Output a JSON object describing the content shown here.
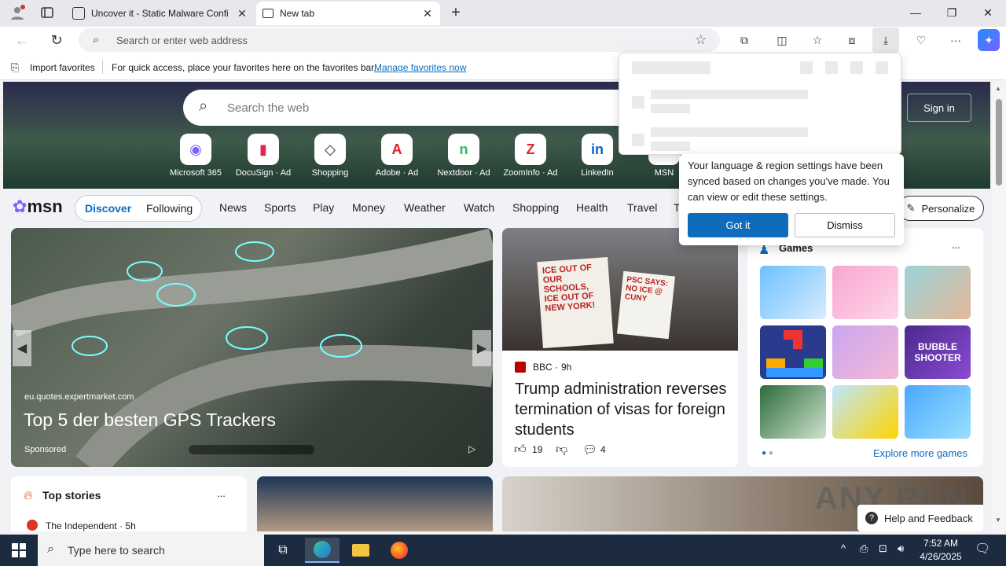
{
  "tabs": {
    "inactive_title": "Uncover it - Static Malware Confi",
    "active_title": "New tab"
  },
  "addressbar": {
    "placeholder": "Search or enter web address"
  },
  "favorites": {
    "import_label": "Import favorites",
    "message": "For quick access, place your favorites here on the favorites bar.",
    "manage_link": "Manage favorites now"
  },
  "hero": {
    "search_placeholder": "Search the web",
    "signin_label": "Sign in",
    "quicklinks": [
      {
        "label": "Microsoft 365",
        "glyph": "◉",
        "color": "#7b61ff"
      },
      {
        "label": "DocuSign · Ad",
        "glyph": "▮",
        "color": "#e3264f"
      },
      {
        "label": "Shopping",
        "glyph": "◇",
        "color": "#333333"
      },
      {
        "label": "Adobe · Ad",
        "glyph": "A",
        "color": "#e41e26"
      },
      {
        "label": "Nextdoor · Ad",
        "glyph": "n",
        "color": "#1bbf5b"
      },
      {
        "label": "ZoomInfo · Ad",
        "glyph": "Z",
        "color": "#e12a2a"
      },
      {
        "label": "LinkedIn",
        "glyph": "in",
        "color": "#0a66c2"
      },
      {
        "label": "MSN",
        "glyph": "✿",
        "color": "#f25022"
      }
    ]
  },
  "msn_nav": {
    "logo": "msn",
    "discover": "Discover",
    "following": "Following",
    "items": [
      "News",
      "Sports",
      "Play",
      "Money",
      "Weather",
      "Watch",
      "Shopping",
      "Health",
      "Travel",
      "T"
    ],
    "personalize": "Personalize"
  },
  "card_main": {
    "source": "eu.quotes.expertmarket.com",
    "headline": "Top 5 der besten GPS Trackers",
    "sponsored": "Sponsored"
  },
  "card_news": {
    "source": "BBC",
    "age": "9h",
    "headline": "Trump administration reverses termination of visas for foreign students",
    "likes": "19",
    "comments": "4",
    "sign_texts": [
      "ICE OUT OF OUR SCHOOLS, ICE OUT OF NEW YORK!",
      "PSC SAYS: NO ICE @ CUNY"
    ]
  },
  "card_games": {
    "title": "Games",
    "more": "...",
    "explore": "Explore more games",
    "bubble_text": "BUBBLE SHOOTER"
  },
  "top_stories": {
    "title": "Top stories",
    "more": "...",
    "first_source": "The Independent · 5h"
  },
  "language_popup": {
    "message": "Your language & region settings have been synced based on changes you've made. You can view or edit these settings.",
    "gotit": "Got it",
    "dismiss": "Dismiss"
  },
  "help_button": "Help and Feedback",
  "watermark": "ANY RUN",
  "taskbar": {
    "search_placeholder": "Type here to search",
    "time": "7:52 AM",
    "date": "4/26/2025"
  }
}
